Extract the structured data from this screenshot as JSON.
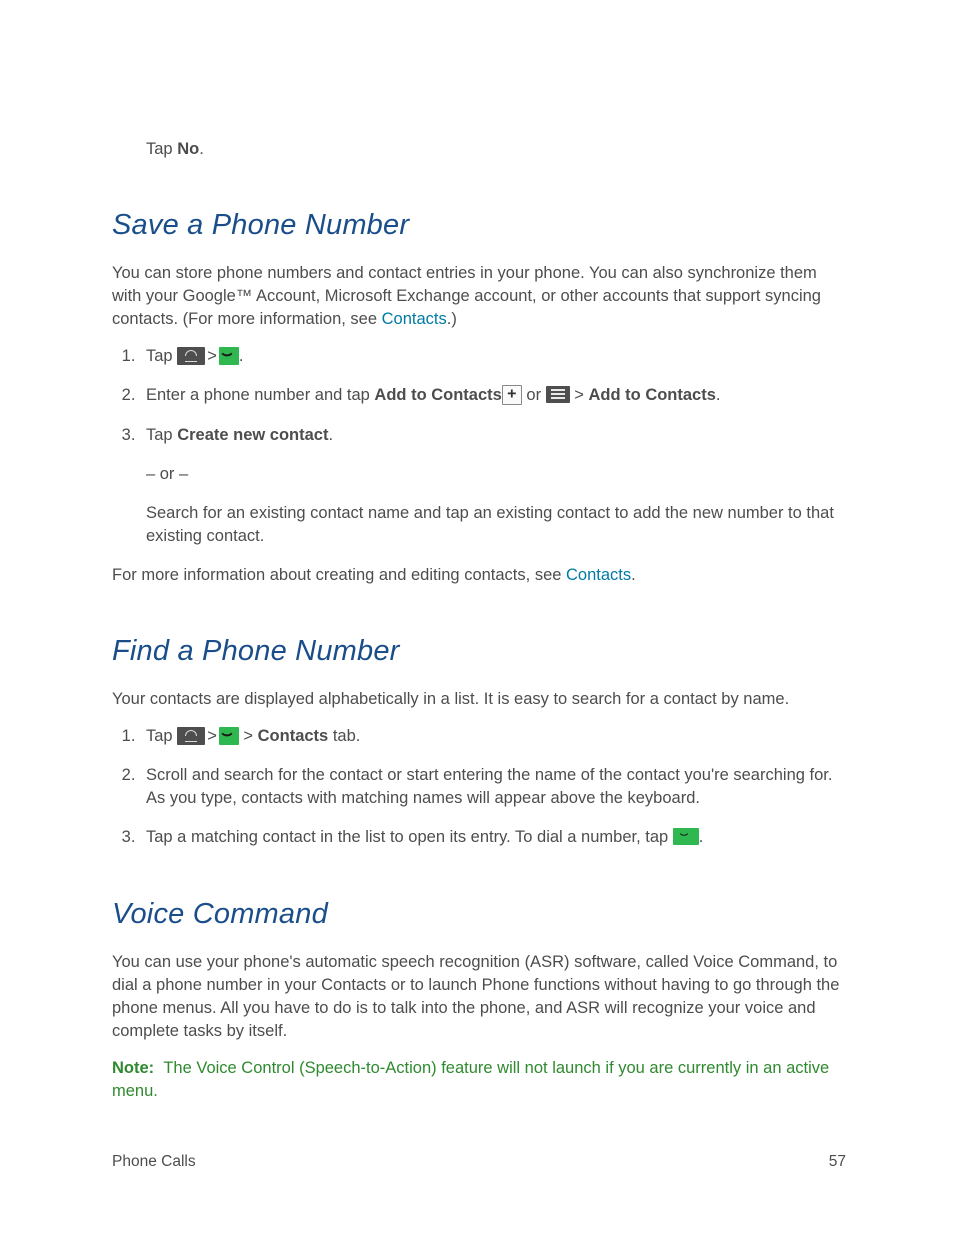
{
  "top_line": {
    "prefix": "Tap ",
    "bold": "No",
    "suffix": "."
  },
  "section1": {
    "heading": "Save a Phone Number",
    "intro_before_link": "You can store phone numbers and contact entries in your phone. You can also synchronize them with your Google™ Account, Microsoft Exchange account, or other accounts that support syncing contacts. (For more information, see ",
    "intro_link": "Contacts",
    "intro_after_link": ".)",
    "steps": {
      "s1_prefix": "Tap ",
      "s1_suffix": ".",
      "s2_prefix": "Enter a phone number and tap ",
      "s2_bold1": "Add to Contacts",
      "s2_mid": " or ",
      "s2_gt": " > ",
      "s2_bold2": "Add to Contacts",
      "s2_suffix": ".",
      "s3_prefix": "Tap ",
      "s3_bold": "Create new contact",
      "s3_suffix": ".",
      "s3_or": "– or –",
      "s3_alt": "Search for an existing contact name and tap an existing contact to add the new number to that existing contact."
    },
    "outro_before_link": "For more information about creating and editing contacts, see ",
    "outro_link": "Contacts",
    "outro_after_link": "."
  },
  "section2": {
    "heading": "Find a Phone Number",
    "intro": "Your contacts are displayed alphabetically in a list. It is easy to search for a contact by name.",
    "steps": {
      "s1_prefix": "Tap ",
      "s1_mid_gt": " > ",
      "s1_bold": "Contacts",
      "s1_suffix": " tab.",
      "s2": "Scroll and search for the contact or start entering the name of the contact you're searching for. As you type, contacts with matching names will appear above the keyboard.",
      "s3_prefix": "Tap a matching contact in the list to open its entry. To dial a number, tap ",
      "s3_suffix": "."
    }
  },
  "section3": {
    "heading": "Voice Command",
    "intro": "You can use your phone's automatic speech recognition (ASR) software, called Voice Command, to dial a phone number in your Contacts or to launch Phone functions without having to go through the phone menus. All you have to do is to talk into the phone, and ASR will recognize your voice and complete tasks by itself.",
    "note_label": "Note:",
    "note_body": "The Voice Control (Speech-to-Action) feature will not launch if you are currently in an active menu."
  },
  "footer": {
    "left": "Phone Calls",
    "right": "57"
  },
  "symbols": {
    "gt": ">"
  }
}
